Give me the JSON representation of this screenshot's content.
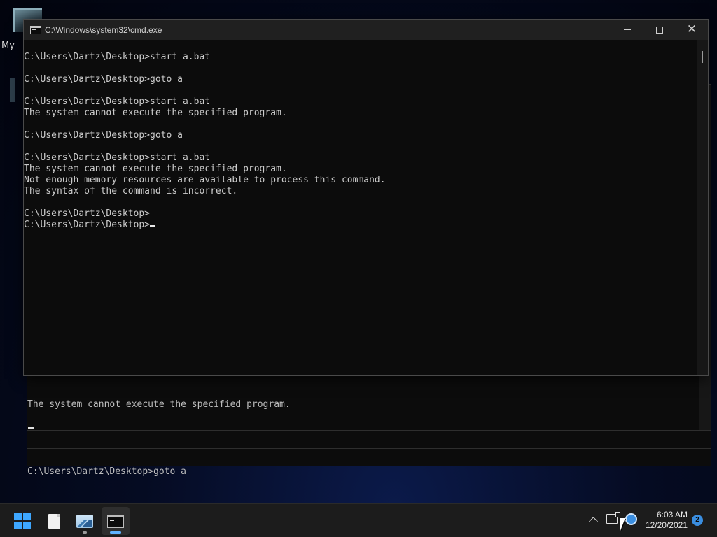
{
  "desktop": {
    "label_fragment": "My"
  },
  "background_window": {
    "lines": [
      "The system cannot execute the specified program.",
      "",
      "C:\\Users\\Dartz\\Desktop>goto a"
    ]
  },
  "cmd_window": {
    "title": "C:\\Windows\\system32\\cmd.exe",
    "icon": "cmd-icon",
    "buttons": {
      "minimize": "minimize-icon",
      "maximize": "maximize-icon",
      "close": "close-icon"
    },
    "lines": [
      "C:\\Users\\Dartz\\Desktop>start a.bat",
      "",
      "C:\\Users\\Dartz\\Desktop>goto a",
      "",
      "C:\\Users\\Dartz\\Desktop>start a.bat",
      "The system cannot execute the specified program.",
      "",
      "C:\\Users\\Dartz\\Desktop>goto a",
      "",
      "C:\\Users\\Dartz\\Desktop>start a.bat",
      "The system cannot execute the specified program.",
      "Not enough memory resources are available to process this command.",
      "The syntax of the command is incorrect.",
      "",
      "C:\\Users\\Dartz\\Desktop>",
      "C:\\Users\\Dartz\\Desktop>"
    ]
  },
  "taskbar": {
    "apps": [
      {
        "name": "start",
        "icon": "windows-logo-icon"
      },
      {
        "name": "notepad",
        "icon": "notepad-icon"
      },
      {
        "name": "photos",
        "icon": "photos-icon"
      },
      {
        "name": "command-prompt",
        "icon": "cmd-icon",
        "active": true
      }
    ],
    "tray": {
      "chevron": "chevron-up-icon",
      "network": "network-icon",
      "app": "tray-app-icon"
    },
    "clock": {
      "time": "6:03 AM",
      "date": "12/20/2021"
    },
    "notification_count": "2"
  },
  "colors": {
    "console_bg": "#0c0c0c",
    "console_text": "#cccccc",
    "titlebar": "#202020",
    "taskbar": "#1c1c1c",
    "accent": "#3ea7ff"
  }
}
